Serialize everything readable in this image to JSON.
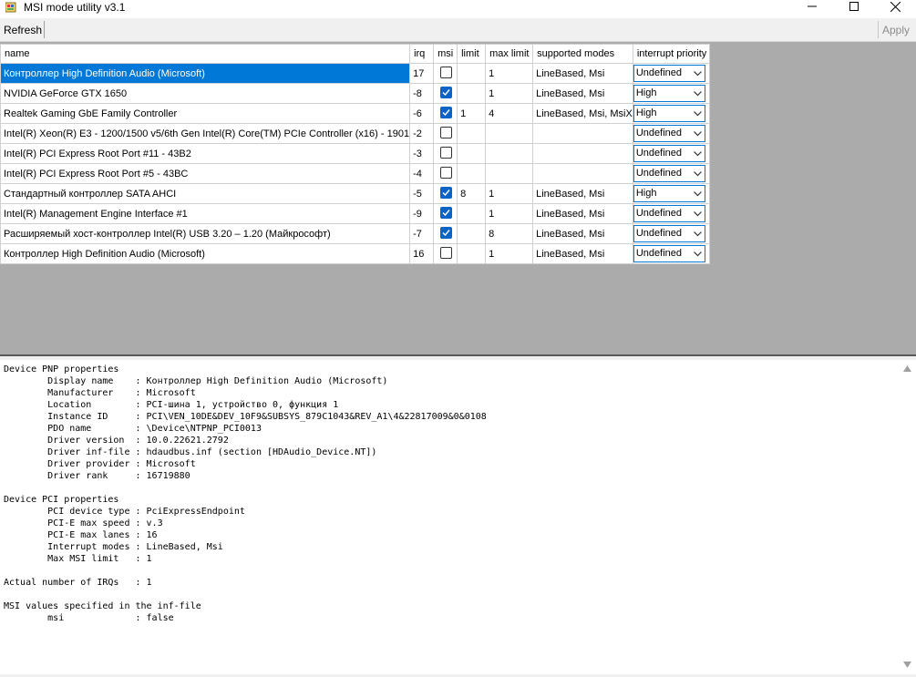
{
  "window": {
    "title": "MSI mode utility v3.1"
  },
  "toolbar": {
    "refresh": "Refresh",
    "apply": "Apply"
  },
  "columns": [
    "name",
    "irq",
    "msi",
    "limit",
    "max limit",
    "supported modes",
    "interrupt priority"
  ],
  "rows": [
    {
      "name": "Контроллер High Definition Audio (Microsoft)",
      "irq": "17",
      "msi": false,
      "limit": "",
      "max_limit": "1",
      "modes": "LineBased, Msi",
      "priority": "Undefined"
    },
    {
      "name": "NVIDIA GeForce GTX 1650",
      "irq": "-8",
      "msi": true,
      "limit": "",
      "max_limit": "1",
      "modes": "LineBased, Msi",
      "priority": "High"
    },
    {
      "name": "Realtek Gaming GbE Family Controller",
      "irq": "-6",
      "msi": true,
      "limit": "1",
      "max_limit": "4",
      "modes": "LineBased, Msi, MsiX",
      "priority": "High"
    },
    {
      "name": "Intel(R) Xeon(R) E3 - 1200/1500 v5/6th Gen Intel(R) Core(TM) PCIe Controller (x16) - 1901",
      "irq": "-2",
      "msi": false,
      "limit": "",
      "max_limit": "",
      "modes": "",
      "priority": "Undefined"
    },
    {
      "name": "Intel(R) PCI Express Root Port #11 - 43B2",
      "irq": "-3",
      "msi": false,
      "limit": "",
      "max_limit": "",
      "modes": "",
      "priority": "Undefined"
    },
    {
      "name": "Intel(R) PCI Express Root Port #5 - 43BC",
      "irq": "-4",
      "msi": false,
      "limit": "",
      "max_limit": "",
      "modes": "",
      "priority": "Undefined"
    },
    {
      "name": "Стандартный контроллер SATA AHCI",
      "irq": "-5",
      "msi": true,
      "limit": "8",
      "max_limit": "1",
      "modes": "LineBased, Msi",
      "priority": "High"
    },
    {
      "name": "Intel(R) Management Engine Interface #1",
      "irq": "-9",
      "msi": true,
      "limit": "",
      "max_limit": "1",
      "modes": "LineBased, Msi",
      "priority": "Undefined"
    },
    {
      "name": "Расширяемый хост-контроллер Intel(R) USB 3.20 – 1.20 (Майкрософт)",
      "irq": "-7",
      "msi": true,
      "limit": "",
      "max_limit": "8",
      "modes": "LineBased, Msi",
      "priority": "Undefined"
    },
    {
      "name": "Контроллер High Definition Audio (Microsoft)",
      "irq": "16",
      "msi": false,
      "limit": "",
      "max_limit": "1",
      "modes": "LineBased, Msi",
      "priority": "Undefined"
    }
  ],
  "details": [
    "Device PNP properties",
    "        Display name    : Контроллер High Definition Audio (Microsoft)",
    "        Manufacturer    : Microsoft",
    "        Location        : PCI-шина 1, устройство 0, функция 1",
    "        Instance ID     : PCI\\VEN_10DE&DEV_10F9&SUBSYS_879C1043&REV_A1\\4&22817009&0&0108",
    "        PDO name        : \\Device\\NTPNP_PCI0013",
    "        Driver version  : 10.0.22621.2792",
    "        Driver inf-file : hdaudbus.inf (section [HDAudio_Device.NT])",
    "        Driver provider : Microsoft",
    "        Driver rank     : 16719880",
    "",
    "Device PCI properties",
    "        PCI device type : PciExpressEndpoint",
    "        PCI-E max speed : v.3",
    "        PCI-E max lanes : 16",
    "        Interrupt modes : LineBased, Msi",
    "        Max MSI limit   : 1",
    "",
    "Actual number of IRQs   : 1",
    "",
    "MSI values specified in the inf-file",
    "        msi             : false"
  ],
  "icons": {
    "app": "msi-utility-icon",
    "minimize": "minimize-icon",
    "maximize": "maximize-icon",
    "close": "close-icon",
    "checkbox_checked": "check-icon",
    "dropdown": "chevron-down-icon"
  },
  "colors": {
    "selection": "#0078d7",
    "checkbox_on": "#0a64c8",
    "grid_bg": "#ababab"
  }
}
